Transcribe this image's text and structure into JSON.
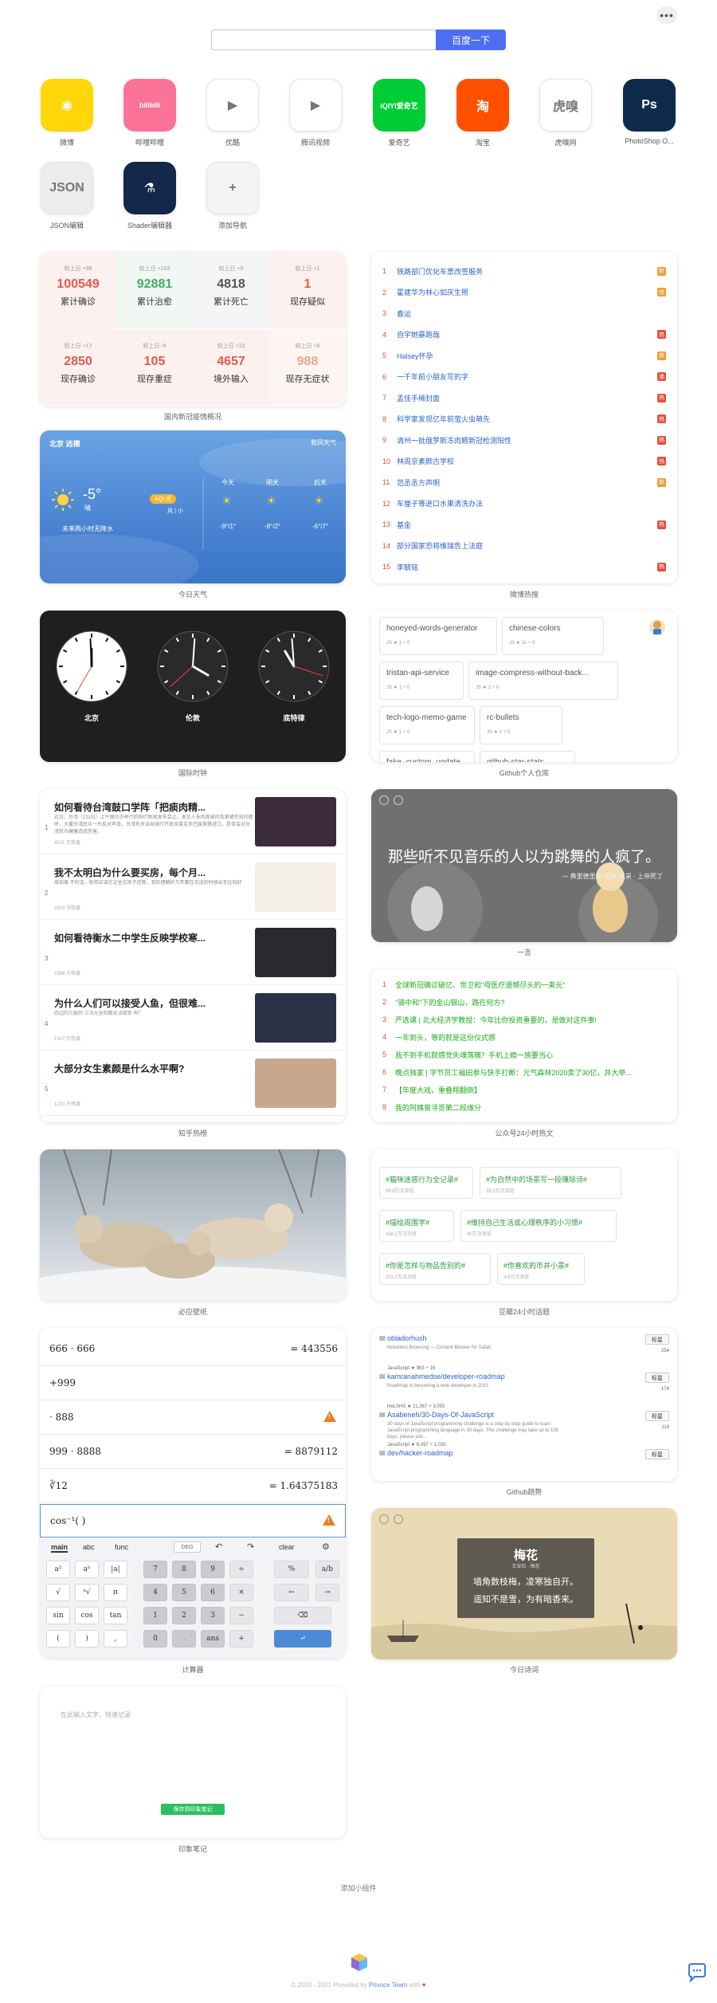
{
  "search": {
    "button_label": "百度一下",
    "placeholder": ""
  },
  "apps": [
    {
      "label": "微博",
      "icon": "weibo-icon",
      "color": "#ffd60a",
      "glyph": "◉"
    },
    {
      "label": "哔哩哔哩",
      "icon": "bilibili-icon",
      "color": "#fb7299",
      "glyph": "bilibili"
    },
    {
      "label": "优酷",
      "icon": "youku-icon",
      "color": "#ffffff",
      "glyph": "▶"
    },
    {
      "label": "腾讯视频",
      "icon": "tencent-video-icon",
      "color": "#ffffff",
      "glyph": "▶"
    },
    {
      "label": "爱奇艺",
      "icon": "iqiyi-icon",
      "color": "#00cc36",
      "glyph": "iQIYI爱奇艺"
    },
    {
      "label": "淘宝",
      "icon": "taobao-icon",
      "color": "#ff5000",
      "glyph": "淘"
    },
    {
      "label": "虎嗅网",
      "icon": "huxiu-icon",
      "color": "#ffffff",
      "glyph": "虎嗅"
    },
    {
      "label": "PhotoShop O...",
      "icon": "photoshop-icon",
      "color": "#0f2a4a",
      "glyph": "Ps"
    },
    {
      "label": "JSON编辑",
      "icon": "json-editor-icon",
      "color": "#ececec",
      "glyph": "JSON"
    },
    {
      "label": "Shader编辑器",
      "icon": "shader-editor-icon",
      "color": "#142849",
      "glyph": "⚗"
    },
    {
      "label": "添加导航",
      "icon": "add-nav-icon",
      "color": "#f4f4f4",
      "glyph": "+"
    }
  ],
  "covid": {
    "caption": "国内新冠疫情概况",
    "cells": [
      {
        "delta": "较上日 +98",
        "num": "100549",
        "label": "累计确诊",
        "color": "#e05a4f"
      },
      {
        "delta": "较上日 +103",
        "num": "92881",
        "label": "累计治愈",
        "color": "#3bae68"
      },
      {
        "delta": "较上日 +0",
        "num": "4818",
        "label": "累计死亡",
        "color": "#555555"
      },
      {
        "delta": "较上日 +1",
        "num": "1",
        "label": "现存疑似",
        "color": "#e05a4f"
      },
      {
        "delta": "较上日 +17",
        "num": "2850",
        "label": "现存确诊",
        "color": "#e05a4f"
      },
      {
        "delta": "较上日 -6",
        "num": "105",
        "label": "现存重症",
        "color": "#e05a4f"
      },
      {
        "delta": "较上日 +15",
        "num": "4657",
        "label": "境外输入",
        "color": "#e05a4f"
      },
      {
        "delta": "较上日 +8",
        "num": "988",
        "label": "现存无症状",
        "color": "#f3a28f"
      }
    ]
  },
  "weibo_hot": {
    "caption": "微博热搜",
    "items": [
      {
        "rank": "1",
        "text": "铁路部门优化车票改签服务",
        "tag": "新",
        "tag_color": "#f39c30"
      },
      {
        "rank": "2",
        "text": "霍建华为林心如庆生照",
        "tag": "热",
        "tag_color": "#f39c30"
      },
      {
        "rank": "3",
        "text": "春运",
        "tag": "",
        "tag_color": ""
      },
      {
        "rank": "4",
        "text": "自宇她暴跑哉",
        "tag": "热",
        "tag_color": "#e74c3c"
      },
      {
        "rank": "5",
        "text": "Halsey怀孕",
        "tag": "新",
        "tag_color": "#f39c30"
      },
      {
        "rank": "6",
        "text": "一千年前小朋友写的字",
        "tag": "沸",
        "tag_color": "#e74c3c"
      },
      {
        "rank": "7",
        "text": "孟佳手稀封面",
        "tag": "热",
        "tag_color": "#e74c3c"
      },
      {
        "rank": "8",
        "text": "科学家发现亿年前萤火虫萌先",
        "tag": "热",
        "tag_color": "#e74c3c"
      },
      {
        "rank": "9",
        "text": "清州一批俄罗斯冻肉鳕新冠检测阳性",
        "tag": "热",
        "tag_color": "#e74c3c"
      },
      {
        "rank": "10",
        "text": "林周京素颜古学校",
        "tag": "热",
        "tag_color": "#e74c3c"
      },
      {
        "rank": "11",
        "text": "范丞丞方声明",
        "tag": "新",
        "tag_color": "#f39c30"
      },
      {
        "rank": "12",
        "text": "车厘子等进口水果清洗办法",
        "tag": "",
        "tag_color": ""
      },
      {
        "rank": "13",
        "text": "基金",
        "tag": "热",
        "tag_color": "#e74c3c"
      },
      {
        "rank": "14",
        "text": "部分国家恐将维瑞告上法庭",
        "tag": "",
        "tag_color": ""
      },
      {
        "rank": "15",
        "text": "李毓铭",
        "tag": "热",
        "tag_color": "#e74c3c"
      }
    ]
  },
  "weather": {
    "caption": "今日天气",
    "city": "北京 远德",
    "source": "和风天气",
    "temp": "-5°",
    "cond": "晴",
    "aqi": "AQI 优",
    "extra": "风 | 小",
    "rain": "未来两小时无降水",
    "days": [
      {
        "name": "今天",
        "range": "-9°/1°"
      },
      {
        "name": "明天",
        "range": "-8°/2°"
      },
      {
        "name": "后天",
        "range": "-6°/7°"
      }
    ]
  },
  "clocks": {
    "caption": "国际时钟",
    "items": [
      {
        "name": "北京"
      },
      {
        "name": "伦敦"
      },
      {
        "name": "底特律"
      }
    ]
  },
  "github_personal": {
    "caption": "Github个人仓库",
    "repos": [
      {
        "name": "honeyed-words-generator",
        "meta": "JS  ★ 1  ⑂ 0"
      },
      {
        "name": "chinese-colors",
        "meta": "JS  ★ 1k  ⑂ 0"
      },
      {
        "name": "tristan-api-service",
        "meta": "JS  ★ 1  ⑂ 0"
      },
      {
        "name": "image-compress-without-back...",
        "meta": "JS  ★ 2  ⑂ 0"
      },
      {
        "name": "tech-logo-memo-game",
        "meta": "JS  ★ 1  ⑂ 0"
      },
      {
        "name": "rc-bullets",
        "meta": "JS  ★ 1  ⑂ 0"
      },
      {
        "name": "fake_custom_update",
        "meta": ""
      },
      {
        "name": "github-star-stats",
        "meta": ""
      }
    ]
  },
  "zhihu": {
    "caption": "知乎热榜",
    "items": [
      {
        "rank": "1",
        "title": "如何看待台湾鼓口学阵「把痰肉精...",
        "desc": "近日，台湾（211日）上午国台办举行的例行新闻发布会上，发言人朱凤莲被问及美猪开放问题时，大量台湾民众一片反对声浪，台湾有关当局强行开放含莱克多巴胺美猪进口，是否会对台湾民众健康造成伤害。",
        "heat": "4521 万热度"
      },
      {
        "rank": "2",
        "title": "我不太明白为什么要买房，每个月...",
        "desc": "周如果 不的话，能否应该在这里买房子还呢，我的理解好几年都在合适的时候出手比较好",
        "heat": "2303 万热度"
      },
      {
        "rank": "3",
        "title": "如何看待衡水二中学生反映学校寒...",
        "desc": "",
        "heat": "1589 万热度"
      },
      {
        "rank": "4",
        "title": "为什么人们可以接受人鱼，但很难...",
        "desc": "四边的三腿的 三次元里的都无法接受 吗？",
        "heat": "1347 万热度"
      },
      {
        "rank": "5",
        "title": "大部分女生素颜是什么水平啊?",
        "desc": "",
        "heat": "1210 万热度"
      }
    ]
  },
  "quote": {
    "caption": "一言",
    "text": "那些听不见音乐的人以为跳舞的人疯了。",
    "author": "— 弗里德里希·威廉·尼采 · 上帝死了"
  },
  "wechat": {
    "caption": "公众号24小时热文",
    "items": [
      {
        "rank": "1",
        "text": "全球新冠确诊破亿、世卫和\"母医疗遗憾尽头的一束光\""
      },
      {
        "rank": "2",
        "text": "\"骑中和\"下的金山银山，路在何方?"
      },
      {
        "rank": "3",
        "text": "严选课 | 北大经济学教授：今年比你投资重要的，是做对这件事!"
      },
      {
        "rank": "4",
        "text": "一年到头，等的就是这份仪式感"
      },
      {
        "rank": "5",
        "text": "我不到手机就感觉失魂落魄？手机上瘾一族要当心"
      },
      {
        "rank": "6",
        "text": "晚点独家 | 字节员工福田参与快手打断：元气森林2020卖了30亿，并大举..."
      },
      {
        "rank": "7",
        "text": "【年度大戏，重叠翔翻倒】"
      },
      {
        "rank": "8",
        "text": "我的阿姨曾寻觅第二段缘分"
      }
    ]
  },
  "wallpaper": {
    "caption": "必应壁纸"
  },
  "douban": {
    "caption": "豆瓣24小时话题",
    "items": [
      {
        "title": "#猫咪迷惑行为全记录#",
        "sub": "99.8万次浏览"
      },
      {
        "title": "#为自然中的场景写一段赚除诗#",
        "sub": "39.1万次浏览"
      },
      {
        "title": "#描绘周围学#",
        "sub": "169.2万次浏览"
      },
      {
        "title": "#维持自己生活或心理秩序的小习惯#",
        "sub": "40万次浏览"
      },
      {
        "title": "#你是怎样与物品告别的#",
        "sub": "203.2万次浏览"
      },
      {
        "title": "#你喜欢的市井小景#",
        "sub": "4.6万次浏览"
      }
    ]
  },
  "calculator": {
    "caption": "计算器",
    "lines": [
      {
        "expr": "666 · 666",
        "result": "= 443556",
        "warn": false
      },
      {
        "expr": "+999",
        "result": "",
        "warn": false
      },
      {
        "expr": "· 888",
        "result": "",
        "warn": true
      },
      {
        "expr": "999 · 8888",
        "result": "= 8879112",
        "warn": false
      },
      {
        "expr": "∛12",
        "result": "= 1.64375183",
        "warn": false
      },
      {
        "expr": "cos⁻¹(  )",
        "result": "",
        "warn": true
      }
    ],
    "tabs": [
      "main",
      "abc",
      "func"
    ],
    "deg": "DEG",
    "clear": "clear",
    "rows": [
      [
        "a²",
        "aᵇ",
        "|a|",
        "7",
        "8",
        "9",
        "÷",
        "%",
        "a/b"
      ],
      [
        "√",
        "ᵇ√",
        "π",
        "4",
        "5",
        "6",
        "×",
        "←",
        "→"
      ],
      [
        "sin",
        "cos",
        "tan",
        "1",
        "2",
        "3",
        "−",
        "⌫",
        ""
      ],
      [
        "(",
        ")",
        ",",
        "0",
        ".",
        "ans",
        "+",
        "↵",
        ""
      ]
    ]
  },
  "github_trending": {
    "caption": "Github趋势",
    "star_label": "标星",
    "items": [
      {
        "name": "obladorhush",
        "desc": "Noiseless Browsing — Content Blocker for Safari",
        "meta": "JavaScript  ★ 963  ⑂ 16",
        "stars": "254"
      },
      {
        "name": "kamranahmedse/developer-roadmap",
        "desc": "Roadmap to becoming a web developer in 2021",
        "meta": "HeLSHS  ★ 21,367  ⑂ 3,055",
        "stars": "174"
      },
      {
        "name": "Asabeneh/30-Days-Of-JavaScript",
        "desc": "30 days of JavaScript programming challenge is a step-by-step guide to learn JavaScript programming language in 30 days. This challenge may take up to 100 days, please just...",
        "meta": "JavaScript  ★ 6,097  ⑂ 1,030",
        "stars": "119"
      },
      {
        "name": "dev/hacker-roadmap",
        "desc": "",
        "meta": "",
        "stars": ""
      }
    ]
  },
  "poem": {
    "caption": "今日诗词",
    "title": "梅花",
    "author": "王安石 · 梅花",
    "line1": "墙角数枝梅，凌寒独自开。",
    "line2": "遥知不是雪，为有暗香来。"
  },
  "note": {
    "caption": "印象笔记",
    "placeholder": "在此输入文字，快速记录",
    "save_label": "保存到印象笔记"
  },
  "add_widget": "添加小组件",
  "footer": {
    "text": "© 2020 - 2021 Provided by ",
    "link": "Privoce Team",
    "with": " with "
  }
}
